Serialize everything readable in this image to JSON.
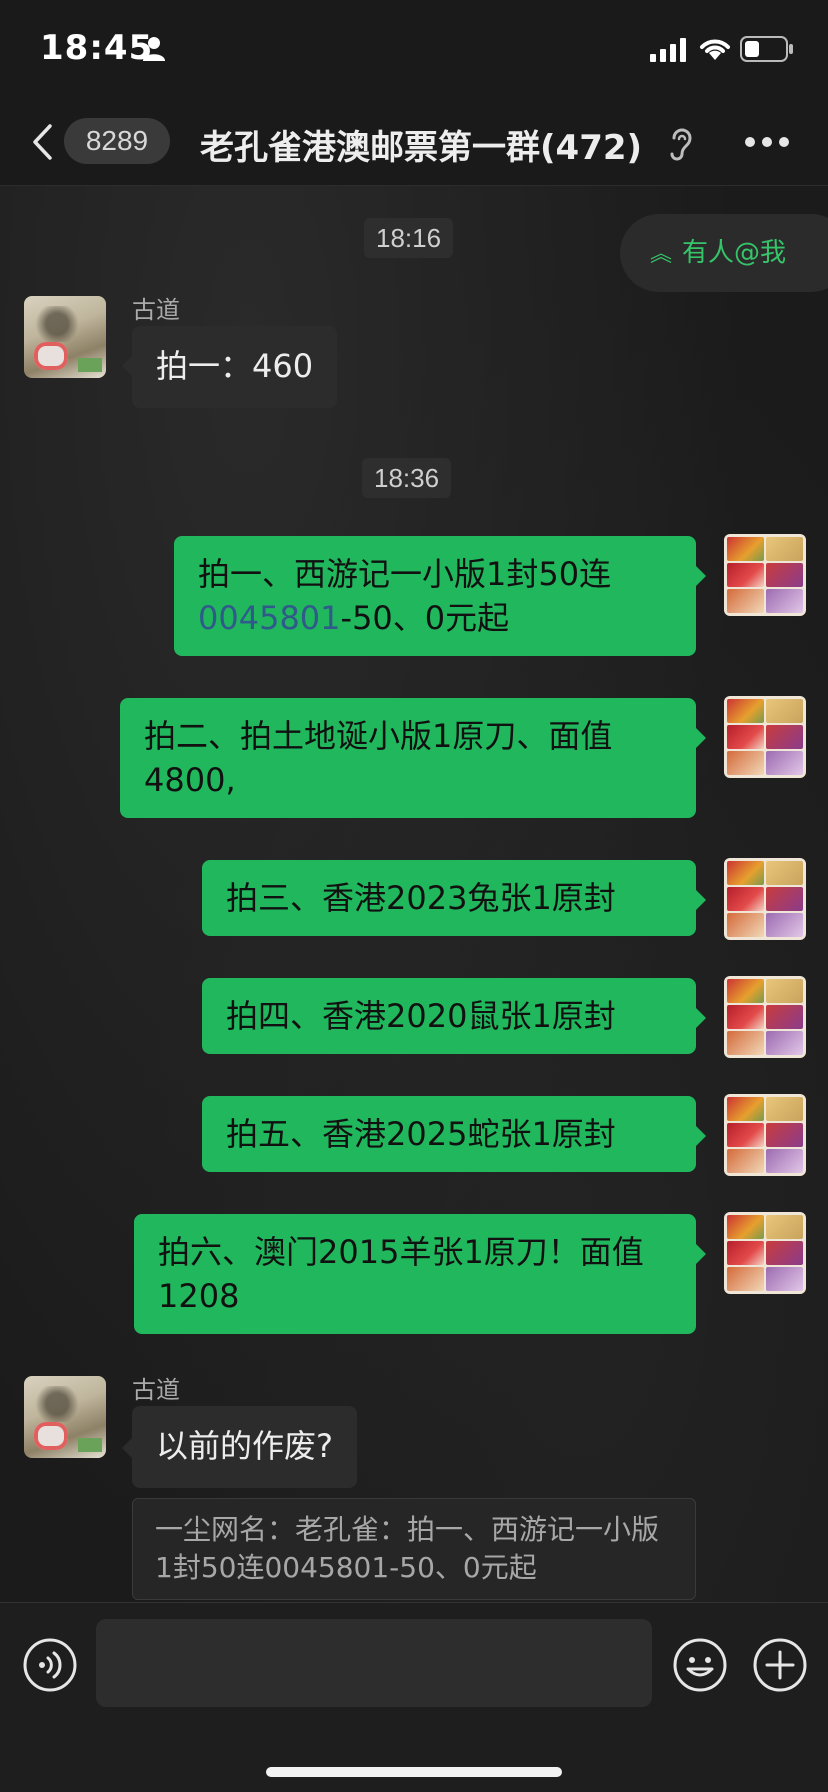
{
  "status_bar": {
    "time": "18:45"
  },
  "nav": {
    "unread_count": "8289",
    "title": "老孔雀港澳邮票第一群(472)"
  },
  "mention": {
    "label": "有人@我"
  },
  "timestamps": [
    "18:16",
    "18:36"
  ],
  "messages": [
    {
      "sender": "古道",
      "text": "拍一：460"
    },
    {
      "text_part1": "拍一、西游记一小版1封50连",
      "link": "0045801",
      "text_part2": "-50、0元起"
    },
    {
      "text": "拍二、拍土地诞小版1原刀、面值4800,"
    },
    {
      "text": "拍三、香港2023兔张1原封"
    },
    {
      "text": "拍四、香港2020鼠张1原封"
    },
    {
      "text": "拍五、香港2025蛇张1原封"
    },
    {
      "text": "拍六、澳门2015羊张1原刀！面值1208"
    },
    {
      "sender": "古道",
      "text": "以前的作废?"
    }
  ],
  "quote": {
    "text": "一尘网名：老孔雀：拍一、西游记一小版1封50连0045801-50、0元起"
  },
  "colors": {
    "outgoing_bubble": "#21b85d",
    "incoming_bubble": "#2c2c2c",
    "mention_text": "#36c46a",
    "link": "#2f5a8a"
  },
  "icons": [
    "back-icon",
    "ear-icon",
    "more-icon",
    "double-chevron-up-icon",
    "voice-icon",
    "emoji-icon",
    "plus-icon"
  ]
}
